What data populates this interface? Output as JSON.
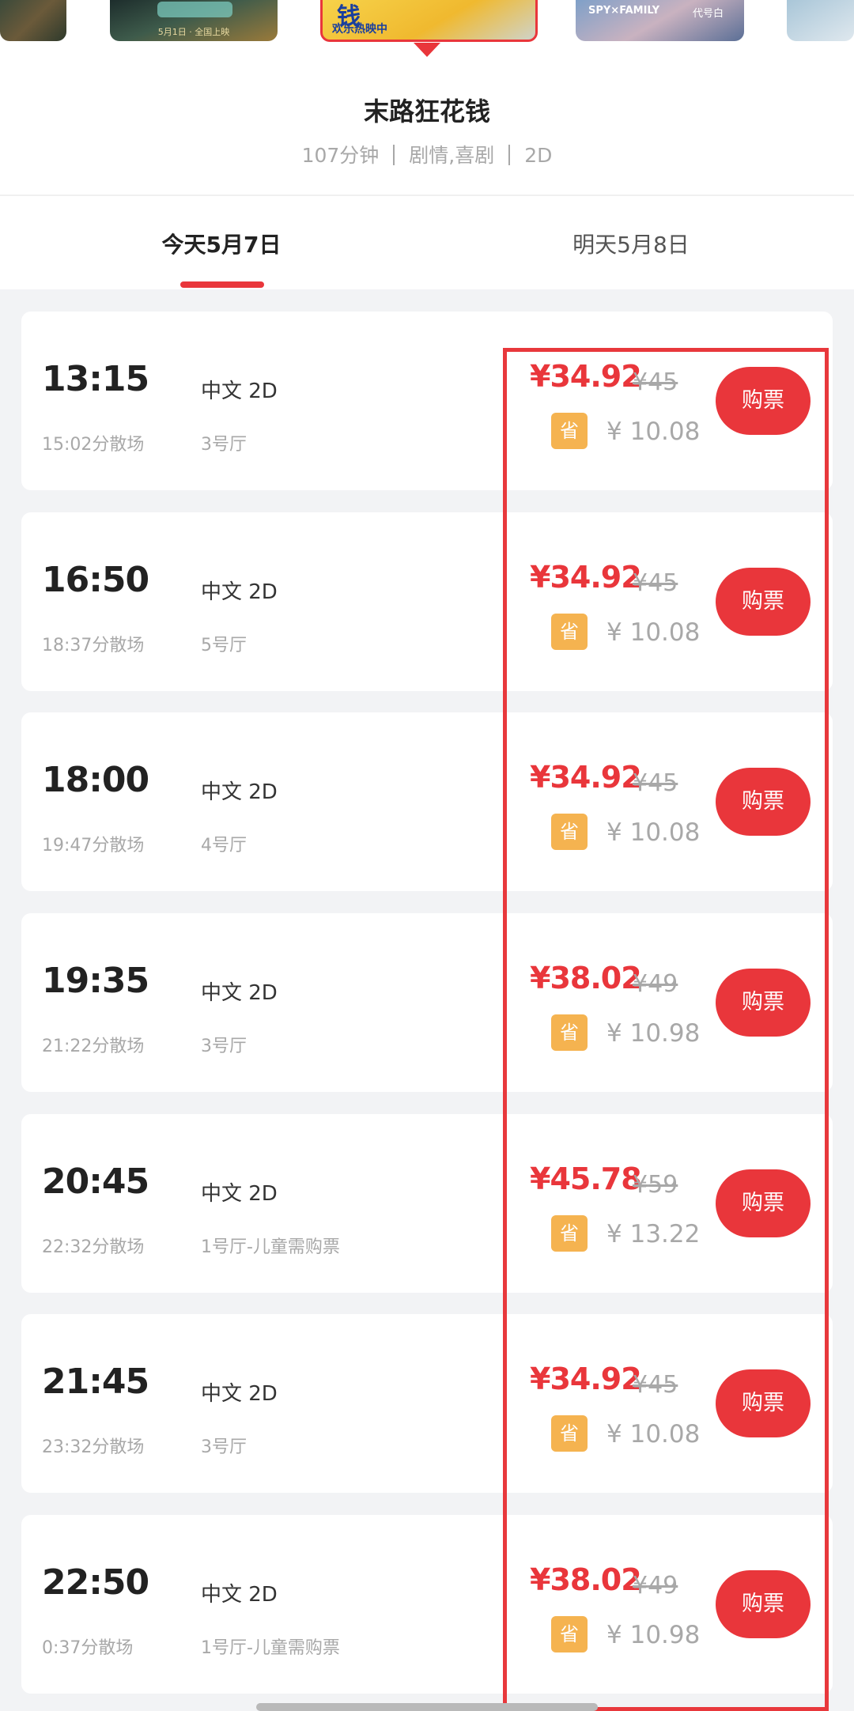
{
  "posters": [
    {
      "name": "poster-partial-left",
      "lines": []
    },
    {
      "name": "poster-adjacent-left",
      "lines": [
        "5月1日 · 全国上映"
      ]
    },
    {
      "name": "poster-selected",
      "lines": [
        "钱",
        "欢乐热映中"
      ]
    },
    {
      "name": "poster-spy-family",
      "lines": [
        "SPY×FAMILY",
        "代号白"
      ]
    },
    {
      "name": "poster-partial-right",
      "lines": []
    }
  ],
  "movie": {
    "title": "末路狂花钱",
    "duration": "107分钟",
    "genres": "剧情,喜剧",
    "format": "2D"
  },
  "tabs": {
    "today": "今天5月7日",
    "tomorrow": "明天5月8日"
  },
  "ui": {
    "buy_label": "购票",
    "save_badge": "省",
    "currency": "¥"
  },
  "showtimes": [
    {
      "time": "13:15",
      "end": "15:02分散场",
      "lang": "中文 2D",
      "hall": "3号厅",
      "price": "34.92",
      "original": "45",
      "save": "10.08"
    },
    {
      "time": "16:50",
      "end": "18:37分散场",
      "lang": "中文 2D",
      "hall": "5号厅",
      "price": "34.92",
      "original": "45",
      "save": "10.08"
    },
    {
      "time": "18:00",
      "end": "19:47分散场",
      "lang": "中文 2D",
      "hall": "4号厅",
      "price": "34.92",
      "original": "45",
      "save": "10.08"
    },
    {
      "time": "19:35",
      "end": "21:22分散场",
      "lang": "中文 2D",
      "hall": "3号厅",
      "price": "38.02",
      "original": "49",
      "save": "10.98"
    },
    {
      "time": "20:45",
      "end": "22:32分散场",
      "lang": "中文 2D",
      "hall": "1号厅-儿童需购票",
      "price": "45.78",
      "original": "59",
      "save": "13.22"
    },
    {
      "time": "21:45",
      "end": "23:32分散场",
      "lang": "中文 2D",
      "hall": "3号厅",
      "price": "34.92",
      "original": "45",
      "save": "10.08"
    },
    {
      "time": "22:50",
      "end": "0:37分散场",
      "lang": "中文 2D",
      "hall": "1号厅-儿童需购票",
      "price": "38.02",
      "original": "49",
      "save": "10.98"
    }
  ],
  "colors": {
    "accent": "#e9363b",
    "save_badge": "#f5b350",
    "muted_text": "#a8a8a8",
    "highlight_frame": "#e8383c"
  }
}
